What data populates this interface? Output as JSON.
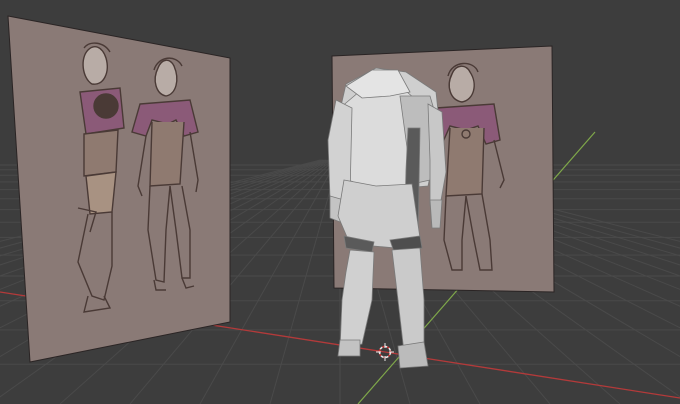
{
  "viewport": {
    "background_color": "#3d3d3d",
    "grid_color": "#4a4a4a",
    "x_axis_color": "#b33a3a",
    "y_axis_color": "#7fa84a"
  },
  "objects": [
    {
      "name": "reference-image-side-and-front",
      "kind": "image-plane"
    },
    {
      "name": "reference-image-front",
      "kind": "image-plane"
    },
    {
      "name": "character-blockout-mesh",
      "kind": "mesh"
    },
    {
      "name": "3d-cursor",
      "icon": "3d-cursor-icon"
    }
  ],
  "colors": {
    "reference_plane": "#8a7a76",
    "mesh_light": "#d6d6d6",
    "mesh_shadow": "#9a9a9a",
    "sketch_line": "#4a3a36",
    "sketch_shirt": "#8b5a78"
  }
}
